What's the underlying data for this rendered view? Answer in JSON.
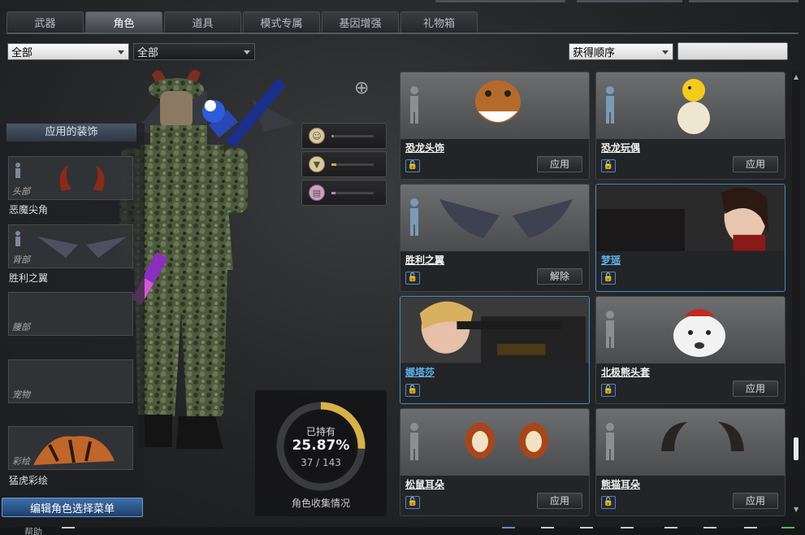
{
  "tabs": [
    {
      "label": "武器"
    },
    {
      "label": "角色"
    },
    {
      "label": "道具"
    },
    {
      "label": "模式专属"
    },
    {
      "label": "基因增强"
    },
    {
      "label": "礼物箱"
    }
  ],
  "active_tab": "角色",
  "filters": {
    "filter1": "全部",
    "filter2": "全部",
    "sort": "获得顺序",
    "search_placeholder": ""
  },
  "applied": {
    "title": "应用的装饰",
    "slots": [
      {
        "label": "头部",
        "item": "恶魔尖角"
      },
      {
        "label": "背部",
        "item": "胜利之翼"
      },
      {
        "label": "腰部",
        "item": ""
      },
      {
        "label": "宠物",
        "item": ""
      },
      {
        "label": "彩绘",
        "item": "猛虎彩绘"
      }
    ]
  },
  "edit_button": "编辑角色选择菜单",
  "stats": [
    {
      "icon": "person-icon",
      "level": 0.05,
      "color": "#888888"
    },
    {
      "icon": "shirt-icon",
      "level": 0.12,
      "color": "#d6a640"
    },
    {
      "icon": "clipboard-icon",
      "level": 0.1,
      "color": "#c57fd0"
    }
  ],
  "collection": {
    "title": "已持有",
    "percent": "25.87%",
    "count": "37 / 143",
    "caption": "角色收集情况"
  },
  "items": [
    {
      "name": "恐龙头饰",
      "action": "应用",
      "selected": false,
      "art": "dino-head"
    },
    {
      "name": "恐龙玩偶",
      "action": "应用",
      "selected": false,
      "art": "dino-egg"
    },
    {
      "name": "胜利之翼",
      "action": "解除",
      "selected": false,
      "art": "wings"
    },
    {
      "name": "梦瑶",
      "action": "",
      "selected": true,
      "art": "woman-photo"
    },
    {
      "name": "娜塔莎",
      "action": "",
      "selected": true,
      "art": "sniper-photo"
    },
    {
      "name": "北极熊头套",
      "action": "应用",
      "selected": false,
      "art": "bear-head"
    },
    {
      "name": "松鼠耳朵",
      "action": "应用",
      "selected": false,
      "art": "squirrel-ears"
    },
    {
      "name": "熊猫耳朵",
      "action": "应用",
      "selected": false,
      "art": "panda-ears"
    }
  ],
  "bottom": {
    "help": "帮助"
  }
}
